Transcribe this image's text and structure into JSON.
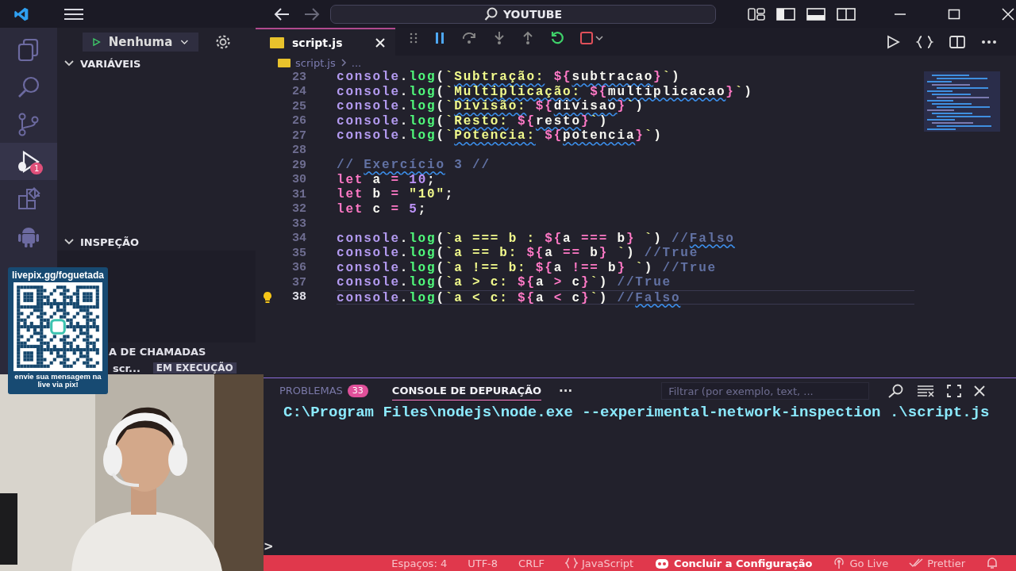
{
  "title_bar": {
    "search": "YOUTUBE"
  },
  "activity_bar": [
    {
      "kind": "files",
      "selected": false
    },
    {
      "kind": "search",
      "selected": false
    },
    {
      "kind": "source-control",
      "selected": false
    },
    {
      "kind": "debug",
      "selected": true,
      "badge": "1"
    },
    {
      "kind": "extensions",
      "selected": false
    },
    {
      "kind": "android",
      "selected": false
    }
  ],
  "sidebar": {
    "launch_config": "Nenhuma",
    "sections": [
      {
        "title": "VARIÁVEIS",
        "expanded": true
      },
      {
        "title": "INSPEÇÃO",
        "expanded": true
      }
    ],
    "call_stack": {
      "title": "A DE CHAMADAS",
      "thread": "scr...",
      "status": "EM EXECUÇÃO"
    }
  },
  "editor": {
    "tab": {
      "label": "script.js",
      "selected": true
    },
    "breadcrumb": [
      "script.js",
      "..."
    ],
    "lines": [
      {
        "number": "23",
        "current": false,
        "tokens": [
          {
            "kind": "o",
            "text": "console"
          },
          {
            "kind": "p",
            "text": "."
          },
          {
            "kind": "f",
            "text": "log"
          },
          {
            "kind": "p",
            "text": "("
          },
          {
            "kind": "s",
            "text": "`"
          },
          {
            "kind": "sw",
            "text": "Subtração:"
          },
          {
            "kind": "i",
            "text": " ${"
          },
          {
            "kind": "vw",
            "text": "subtracao"
          },
          {
            "kind": "i",
            "text": "}"
          },
          {
            "kind": "s",
            "text": "`"
          },
          {
            "kind": "p",
            "text": ")"
          }
        ]
      },
      {
        "number": "24",
        "current": false,
        "tokens": [
          {
            "kind": "o",
            "text": "console"
          },
          {
            "kind": "p",
            "text": "."
          },
          {
            "kind": "f",
            "text": "log"
          },
          {
            "kind": "p",
            "text": "("
          },
          {
            "kind": "s",
            "text": "`"
          },
          {
            "kind": "sw",
            "text": "Multiplicação:"
          },
          {
            "kind": "i",
            "text": " ${"
          },
          {
            "kind": "vw",
            "text": "multiplicacao"
          },
          {
            "kind": "i",
            "text": "}"
          },
          {
            "kind": "s",
            "text": "`"
          },
          {
            "kind": "p",
            "text": ")"
          }
        ]
      },
      {
        "number": "25",
        "current": false,
        "tokens": [
          {
            "kind": "o",
            "text": "console"
          },
          {
            "kind": "p",
            "text": "."
          },
          {
            "kind": "f",
            "text": "log"
          },
          {
            "kind": "p",
            "text": "("
          },
          {
            "kind": "s",
            "text": "`"
          },
          {
            "kind": "sw",
            "text": "Divisão:"
          },
          {
            "kind": "i",
            "text": " ${"
          },
          {
            "kind": "vw",
            "text": "divisao"
          },
          {
            "kind": "i",
            "text": "}"
          },
          {
            "kind": "s",
            "text": "`"
          },
          {
            "kind": "p",
            "text": ")"
          }
        ]
      },
      {
        "number": "26",
        "current": false,
        "tokens": [
          {
            "kind": "o",
            "text": "console"
          },
          {
            "kind": "p",
            "text": "."
          },
          {
            "kind": "f",
            "text": "log"
          },
          {
            "kind": "p",
            "text": "("
          },
          {
            "kind": "s",
            "text": "`"
          },
          {
            "kind": "sw",
            "text": "Resto:"
          },
          {
            "kind": "i",
            "text": " ${"
          },
          {
            "kind": "vw",
            "text": "resto"
          },
          {
            "kind": "i",
            "text": "}"
          },
          {
            "kind": "s",
            "text": "`"
          },
          {
            "kind": "p",
            "text": ")"
          }
        ]
      },
      {
        "number": "27",
        "current": false,
        "tokens": [
          {
            "kind": "o",
            "text": "console"
          },
          {
            "kind": "p",
            "text": "."
          },
          {
            "kind": "f",
            "text": "log"
          },
          {
            "kind": "p",
            "text": "("
          },
          {
            "kind": "s",
            "text": "`"
          },
          {
            "kind": "sw",
            "text": "Potencia:"
          },
          {
            "kind": "i",
            "text": " ${"
          },
          {
            "kind": "vw",
            "text": "potencia"
          },
          {
            "kind": "i",
            "text": "}"
          },
          {
            "kind": "s",
            "text": "`"
          },
          {
            "kind": "p",
            "text": ")"
          }
        ]
      },
      {
        "number": "28",
        "current": false
      },
      {
        "number": "29",
        "current": false,
        "tokens": [
          {
            "kind": "c",
            "text": "// "
          },
          {
            "kind": "cw",
            "text": "Exercício"
          },
          {
            "kind": "c",
            "text": " 3 //"
          }
        ]
      },
      {
        "number": "30",
        "current": false,
        "tokens": [
          {
            "kind": "k",
            "text": "let"
          },
          {
            "kind": "v",
            "text": " a "
          },
          {
            "kind": "i",
            "text": "= "
          },
          {
            "kind": "n",
            "text": "10"
          },
          {
            "kind": "p",
            "text": ";"
          }
        ]
      },
      {
        "number": "31",
        "current": false,
        "tokens": [
          {
            "kind": "k",
            "text": "let"
          },
          {
            "kind": "v",
            "text": " b "
          },
          {
            "kind": "i",
            "text": "= "
          },
          {
            "kind": "s",
            "text": "\"10\""
          },
          {
            "kind": "p",
            "text": ";"
          }
        ]
      },
      {
        "number": "32",
        "current": false,
        "tokens": [
          {
            "kind": "k",
            "text": "let"
          },
          {
            "kind": "v",
            "text": " c "
          },
          {
            "kind": "i",
            "text": "= "
          },
          {
            "kind": "n",
            "text": "5"
          },
          {
            "kind": "p",
            "text": ";"
          }
        ]
      },
      {
        "number": "33",
        "current": false
      },
      {
        "number": "34",
        "current": false,
        "tokens": [
          {
            "kind": "o",
            "text": "console"
          },
          {
            "kind": "p",
            "text": "."
          },
          {
            "kind": "f",
            "text": "log"
          },
          {
            "kind": "p",
            "text": "("
          },
          {
            "kind": "s",
            "text": "`a === b : "
          },
          {
            "kind": "i",
            "text": "${"
          },
          {
            "kind": "v",
            "text": "a "
          },
          {
            "kind": "i",
            "text": "==="
          },
          {
            "kind": "v",
            "text": " b"
          },
          {
            "kind": "i",
            "text": "}"
          },
          {
            "kind": "s",
            "text": " `"
          },
          {
            "kind": "p",
            "text": ")"
          },
          {
            "kind": "c",
            "text": " //"
          },
          {
            "kind": "cw",
            "text": "Falso"
          }
        ]
      },
      {
        "number": "35",
        "current": false,
        "tokens": [
          {
            "kind": "o",
            "text": "console"
          },
          {
            "kind": "p",
            "text": "."
          },
          {
            "kind": "f",
            "text": "log"
          },
          {
            "kind": "p",
            "text": "("
          },
          {
            "kind": "s",
            "text": "`a == b: "
          },
          {
            "kind": "i",
            "text": "${"
          },
          {
            "kind": "v",
            "text": "a "
          },
          {
            "kind": "i",
            "text": "=="
          },
          {
            "kind": "v",
            "text": " b"
          },
          {
            "kind": "i",
            "text": "}"
          },
          {
            "kind": "s",
            "text": " `"
          },
          {
            "kind": "p",
            "text": ")"
          },
          {
            "kind": "c",
            "text": " //True"
          }
        ]
      },
      {
        "number": "36",
        "current": false,
        "tokens": [
          {
            "kind": "o",
            "text": "console"
          },
          {
            "kind": "p",
            "text": "."
          },
          {
            "kind": "f",
            "text": "log"
          },
          {
            "kind": "p",
            "text": "("
          },
          {
            "kind": "s",
            "text": "`a !== b: "
          },
          {
            "kind": "i",
            "text": "${"
          },
          {
            "kind": "v",
            "text": "a "
          },
          {
            "kind": "i",
            "text": "!=="
          },
          {
            "kind": "v",
            "text": " b"
          },
          {
            "kind": "i",
            "text": "}"
          },
          {
            "kind": "s",
            "text": " `"
          },
          {
            "kind": "p",
            "text": ")"
          },
          {
            "kind": "c",
            "text": " //True"
          }
        ]
      },
      {
        "number": "37",
        "current": false,
        "tokens": [
          {
            "kind": "o",
            "text": "console"
          },
          {
            "kind": "p",
            "text": "."
          },
          {
            "kind": "f",
            "text": "log"
          },
          {
            "kind": "p",
            "text": "("
          },
          {
            "kind": "s",
            "text": "`a > c: "
          },
          {
            "kind": "i",
            "text": "${"
          },
          {
            "kind": "v",
            "text": "a "
          },
          {
            "kind": "i",
            "text": ">"
          },
          {
            "kind": "v",
            "text": " c"
          },
          {
            "kind": "i",
            "text": "}"
          },
          {
            "kind": "s",
            "text": "`"
          },
          {
            "kind": "p",
            "text": ")"
          },
          {
            "kind": "c",
            "text": " //True"
          }
        ]
      },
      {
        "number": "38",
        "current": true,
        "tokens": [
          {
            "kind": "o",
            "text": "console"
          },
          {
            "kind": "p",
            "text": "."
          },
          {
            "kind": "f",
            "text": "log"
          },
          {
            "kind": "p",
            "text": "("
          },
          {
            "kind": "s",
            "text": "`a < c: "
          },
          {
            "kind": "i",
            "text": "${"
          },
          {
            "kind": "v",
            "text": "a "
          },
          {
            "kind": "i",
            "text": "<"
          },
          {
            "kind": "v",
            "text": " c"
          },
          {
            "kind": "i",
            "text": "}"
          },
          {
            "kind": "s",
            "text": "`"
          },
          {
            "kind": "p",
            "text": ")"
          },
          {
            "kind": "c",
            "text": " //"
          },
          {
            "kind": "cw",
            "text": "Falso"
          }
        ]
      }
    ]
  },
  "panel": {
    "tabs": [
      {
        "label": "PROBLEMAS",
        "badge": "33",
        "selected": false
      },
      {
        "label": "CONSOLE DE DEPURAÇÃO",
        "selected": true
      }
    ],
    "more": "···",
    "filter_placeholder": "Filtrar (por exemplo, text, ...",
    "output": [
      "C:\\Program Files\\nodejs\\node.exe --experimental-network-inspection .\\script.js"
    ],
    "prompt": ">"
  },
  "status_bar": [
    {
      "kind": "text",
      "label": "Espaços: 4"
    },
    {
      "kind": "text",
      "label": "UTF-8"
    },
    {
      "kind": "text",
      "label": "CRLF"
    },
    {
      "kind": "language",
      "label": "JavaScript"
    },
    {
      "kind": "setup",
      "label": "Concluir a Configuração"
    },
    {
      "kind": "live",
      "label": "Go Live"
    },
    {
      "kind": "prettier",
      "label": "Prettier"
    },
    {
      "kind": "bell"
    }
  ],
  "overlay": {
    "qr": {
      "top_text": "livepix.gg/foguetada",
      "bottom_text": "envie sua mensagem na live via pix!"
    }
  }
}
